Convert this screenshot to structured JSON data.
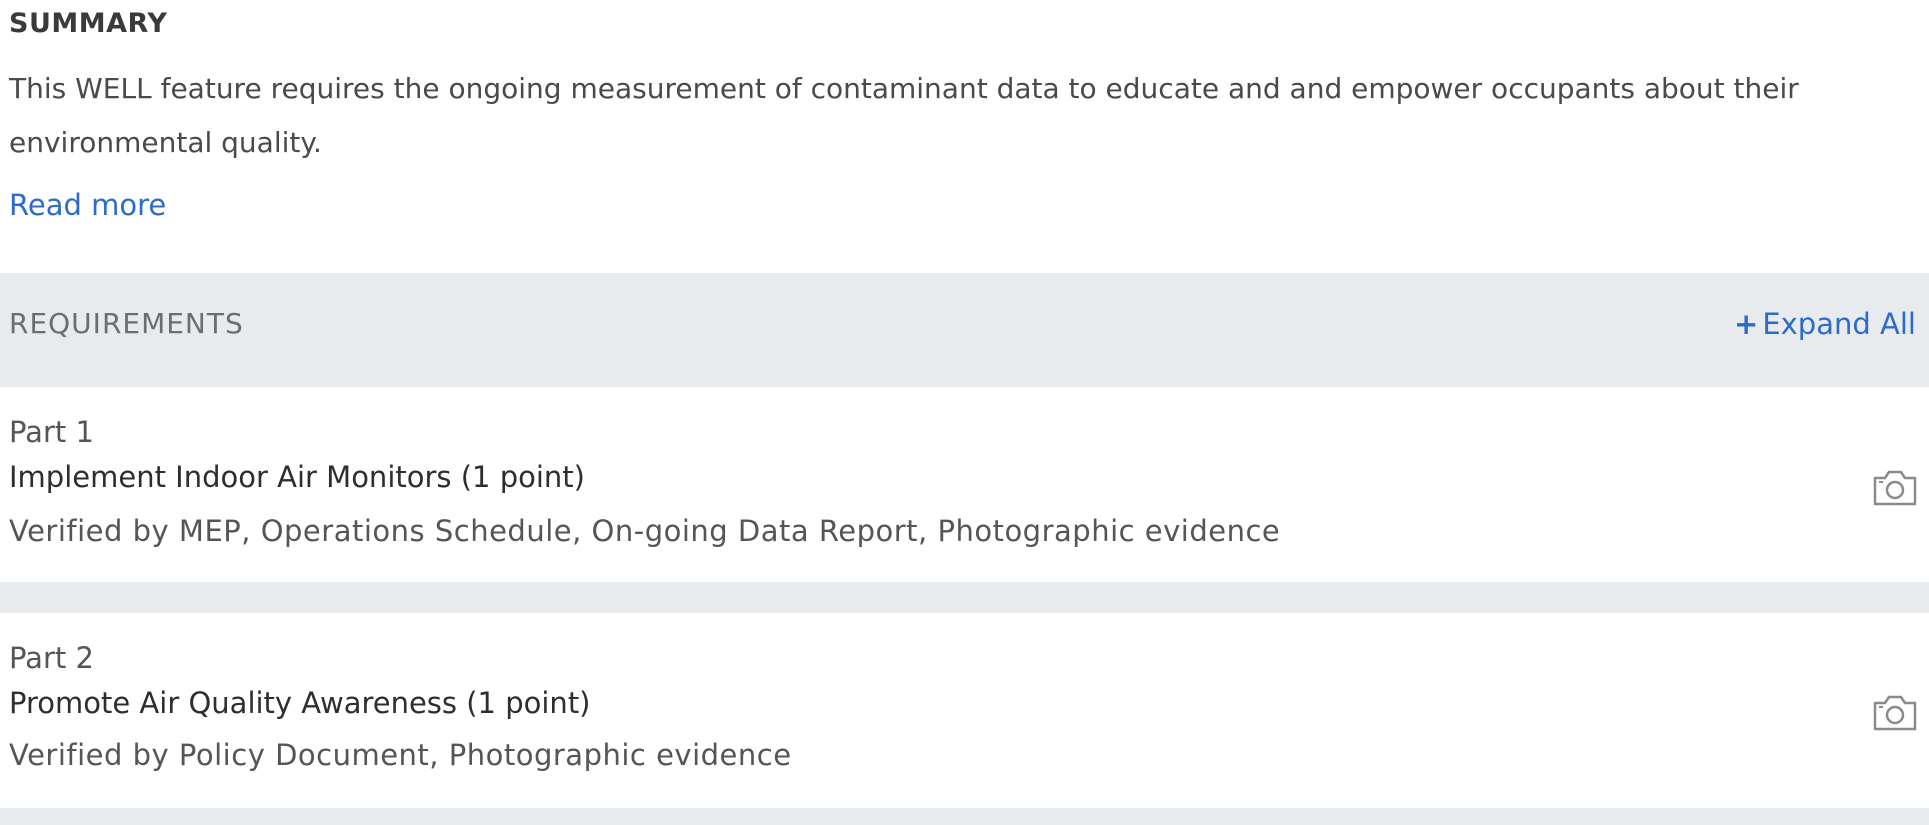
{
  "summary": {
    "title": "SUMMARY",
    "text": "This WELL feature requires the ongoing measurement of contaminant data to educate and and empower occupants about their environmental quality.",
    "read_more": "Read more"
  },
  "requirements": {
    "title": "REQUIREMENTS",
    "expand_all_icon": "+",
    "expand_all_label": "Expand All",
    "parts": [
      {
        "label": "Part 1",
        "name": "Implement Indoor Air Monitors (1 point)",
        "verified": "Verified by MEP, Operations Schedule, On-going Data Report, Photographic evidence",
        "icon": "camera-icon"
      },
      {
        "label": "Part 2",
        "name": "Promote Air Quality Awareness (1 point)",
        "verified": "Verified by Policy Document, Photographic evidence",
        "icon": "camera-icon"
      }
    ]
  },
  "colors": {
    "link": "#2d6bc9",
    "header_bg": "#e8ebee",
    "text": "#4a4a4a"
  }
}
